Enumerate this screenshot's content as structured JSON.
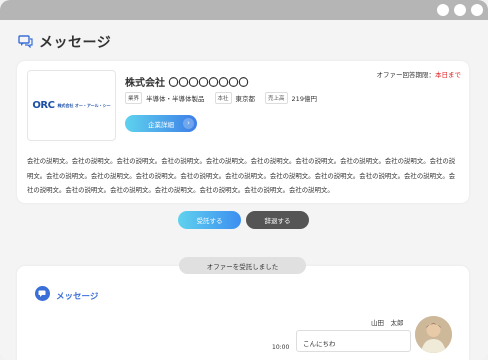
{
  "window": {
    "controls": [
      "dot-1",
      "dot-2",
      "dot-3"
    ]
  },
  "header": {
    "title": "メッセージ",
    "icon": "chat-icon"
  },
  "offer": {
    "logo": {
      "mark": "ORC",
      "text": "株式会社 オー・アール・シー"
    },
    "company_name": "株式会社 〇〇〇〇〇〇〇〇",
    "deadline_label": "オファー回答期限：",
    "deadline_value": "本日まで",
    "tags": [
      {
        "key": "業界",
        "value": "半導体・半導体製品"
      },
      {
        "key": "本社",
        "value": "東京都"
      },
      {
        "key": "売上高",
        "value": "219億円"
      }
    ],
    "detail_button": "企業詳細",
    "description": "会社の説明文。会社の説明文。会社の説明文。会社の説明文。会社の説明文。会社の説明文。会社の説明文。会社の説明文。会社の説明文。会社の説明文。会社の説明文。会社の説明文。会社の説明文。会社の説明文。会社の説明文。会社の説明文。会社の説明文。会社の説明文。会社の説明文。会社の説明文。会社の説明文。会社の説明文。会社の説明文。会社の説明文。会社の説明文。会社の説明文。"
  },
  "actions": {
    "accept": "受託する",
    "decline": "辞退する"
  },
  "thread": {
    "status": "オファーを受託しました",
    "title": "メッセージ",
    "messages": [
      {
        "sender": "山田　太郎",
        "text": "こんにちわ",
        "time": "10:00"
      }
    ]
  },
  "colors": {
    "accent": "#3d7ee8",
    "deadline": "#e02020",
    "decline": "#555555"
  }
}
